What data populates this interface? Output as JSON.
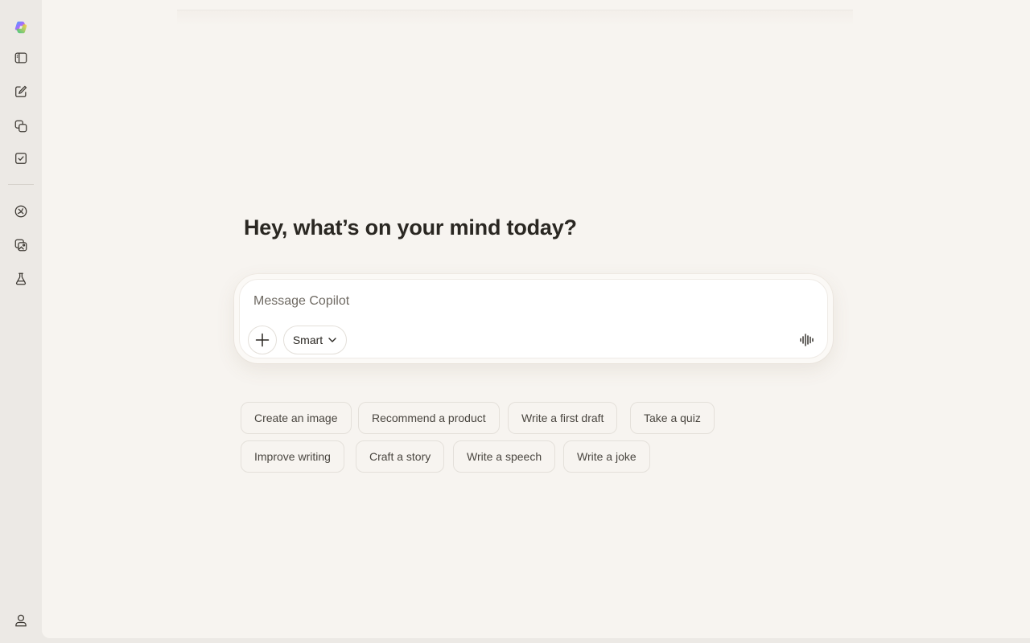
{
  "sidebar": {
    "items": [
      {
        "name": "copilot-logo-icon"
      },
      {
        "name": "sidebar-toggle-icon"
      },
      {
        "name": "new-chat-icon"
      },
      {
        "name": "pages-icon"
      },
      {
        "name": "tasks-icon"
      },
      {
        "name": "discover-icon"
      },
      {
        "name": "image-gallery-icon"
      },
      {
        "name": "labs-icon"
      },
      {
        "name": "profile-icon"
      }
    ]
  },
  "main": {
    "greeting": "Hey, what’s on your mind today?"
  },
  "composer": {
    "placeholder": "Message Copilot",
    "mode_label": "Smart"
  },
  "suggestions": [
    "Create an image",
    "Recommend a product",
    "Write a first draft",
    "Take a quiz",
    "Improve writing",
    "Craft a story",
    "Write a speech",
    "Write a joke"
  ],
  "colors": {
    "sidebar_bg": "#ece9e5",
    "main_bg": "#f7f4f0",
    "text": "#2a2722",
    "chip_border": "#e4e0da"
  }
}
